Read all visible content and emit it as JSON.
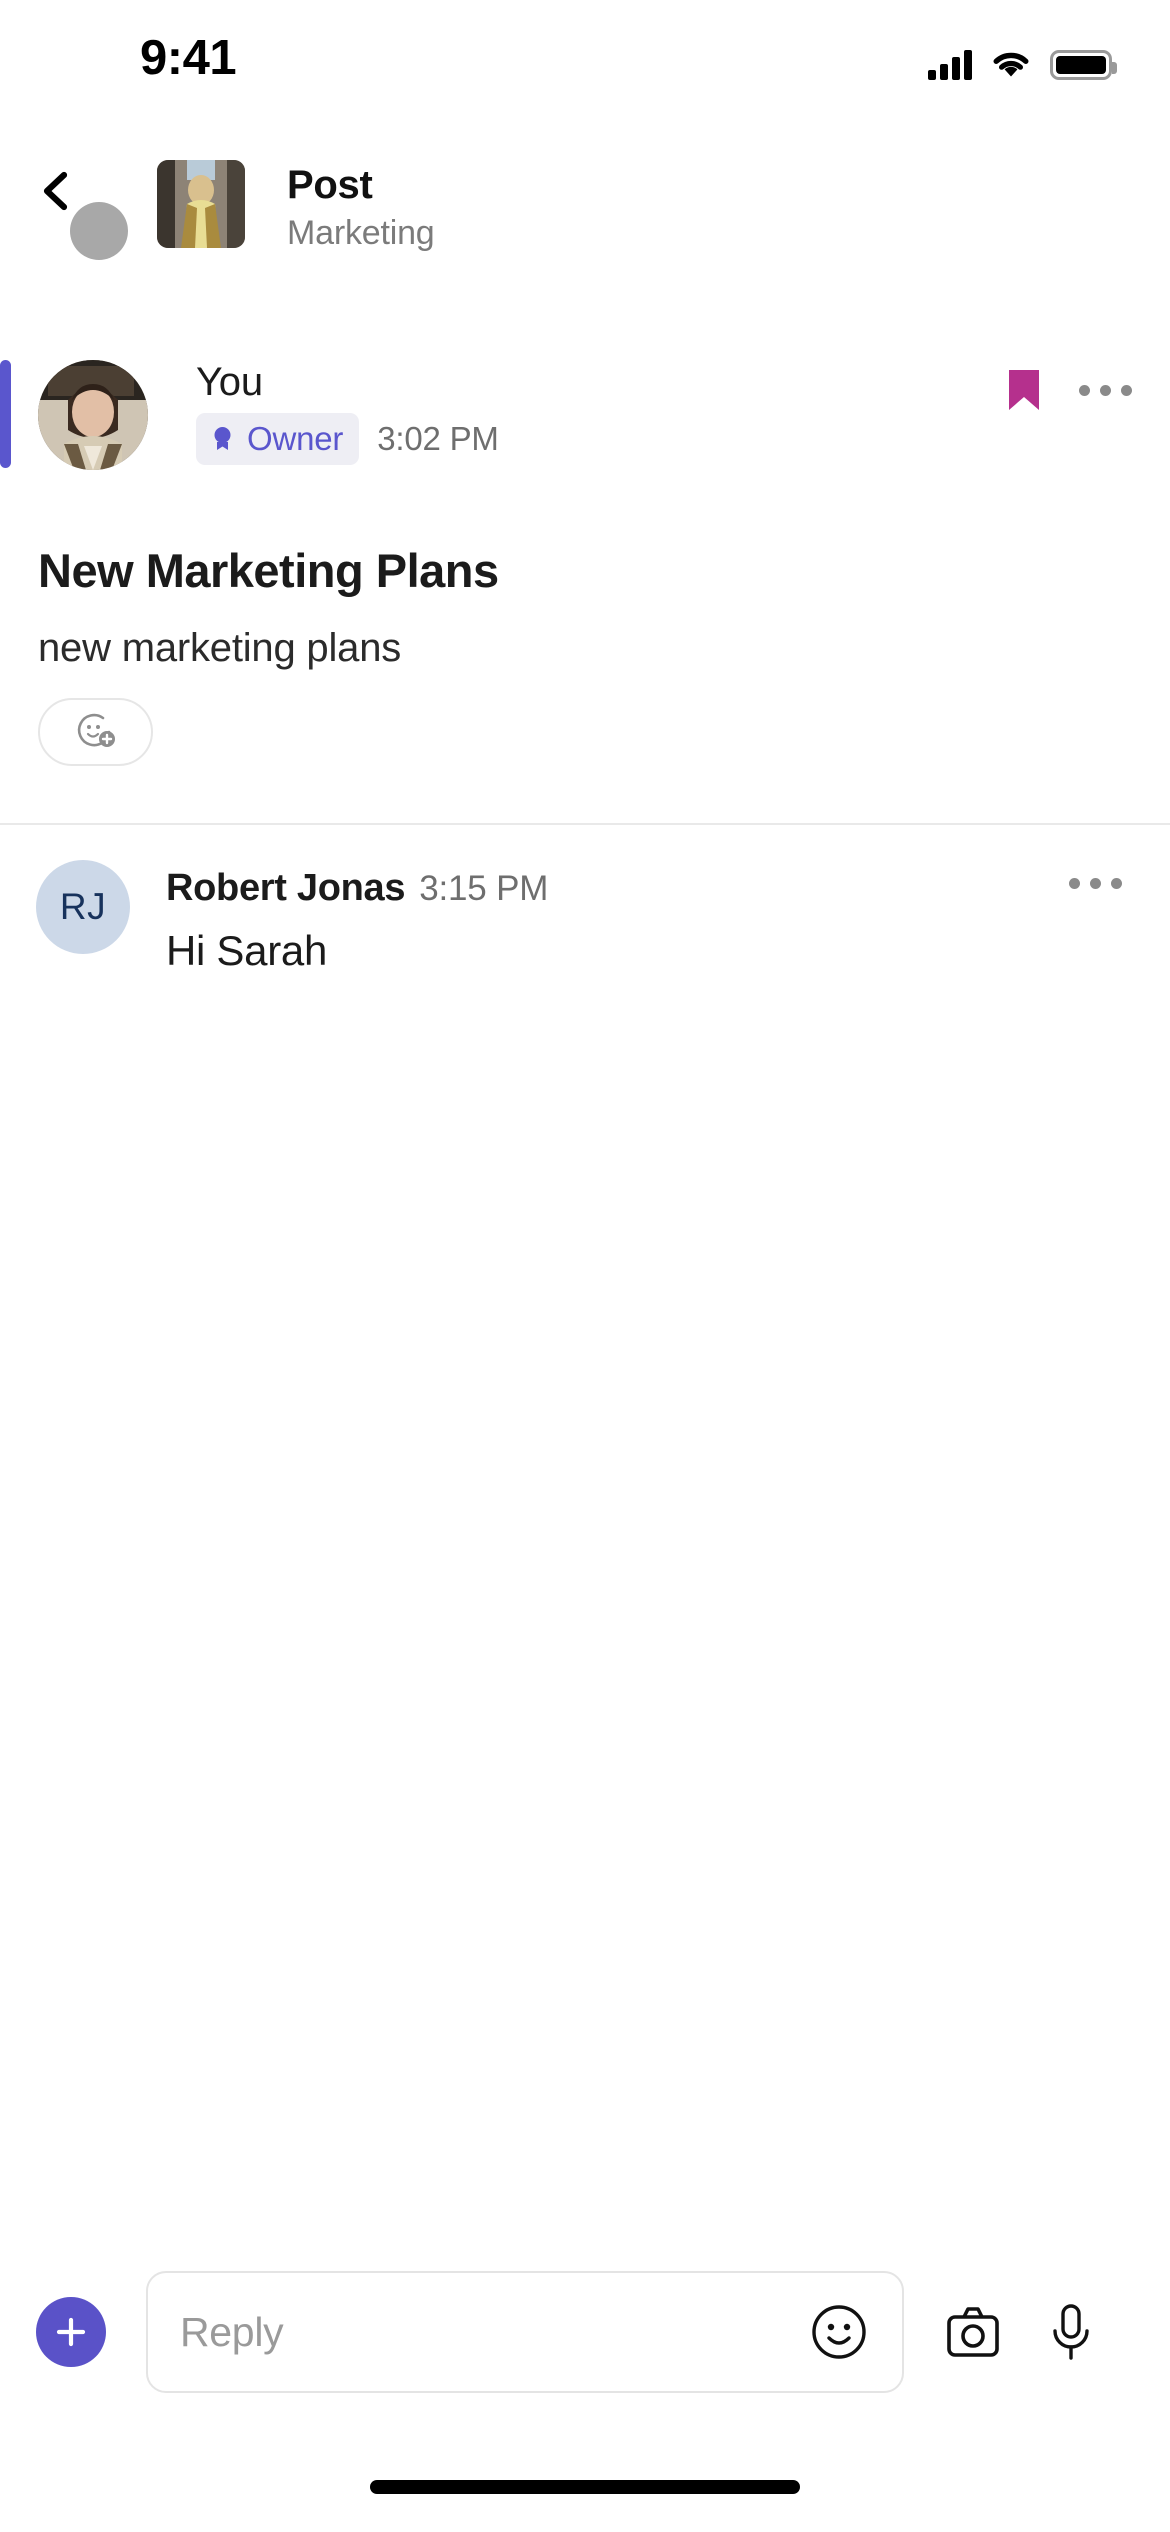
{
  "status_bar": {
    "time": "9:41",
    "signal_icon": "cellular-signal-icon",
    "wifi_icon": "wifi-icon",
    "battery_icon": "battery-full-icon"
  },
  "navbar": {
    "back_icon": "chevron-left-icon",
    "thumbnail_icon": "channel-thumbnail",
    "title": "Post",
    "subtitle": "Marketing"
  },
  "post": {
    "author": "You",
    "badge_label": "Owner",
    "badge_icon": "award-ribbon-icon",
    "time": "3:02 PM",
    "title": "New Marketing Plans",
    "body": "new marketing plans",
    "bookmark_icon": "bookmark-filled-icon",
    "menu_icon": "more-horizontal-icon",
    "reaction_icon": "add-reaction-icon",
    "accent_color": "#5a56cd",
    "bookmark_color": "#b5308d",
    "badge_text_color": "#5a56cd",
    "badge_bg_color": "#eeeef4"
  },
  "reply": {
    "avatar_initials": "RJ",
    "author": "Robert Jonas",
    "time": "3:15 PM",
    "text": "Hi Sarah",
    "menu_icon": "more-horizontal-icon",
    "avatar_bg_color": "#ccd8e8",
    "avatar_text_color": "#17325c"
  },
  "composer": {
    "add_icon": "plus-icon",
    "add_button_color": "#5a52c8",
    "placeholder": "Reply",
    "value": "",
    "emoji_icon": "smiley-icon",
    "camera_icon": "camera-icon",
    "mic_icon": "microphone-icon"
  }
}
